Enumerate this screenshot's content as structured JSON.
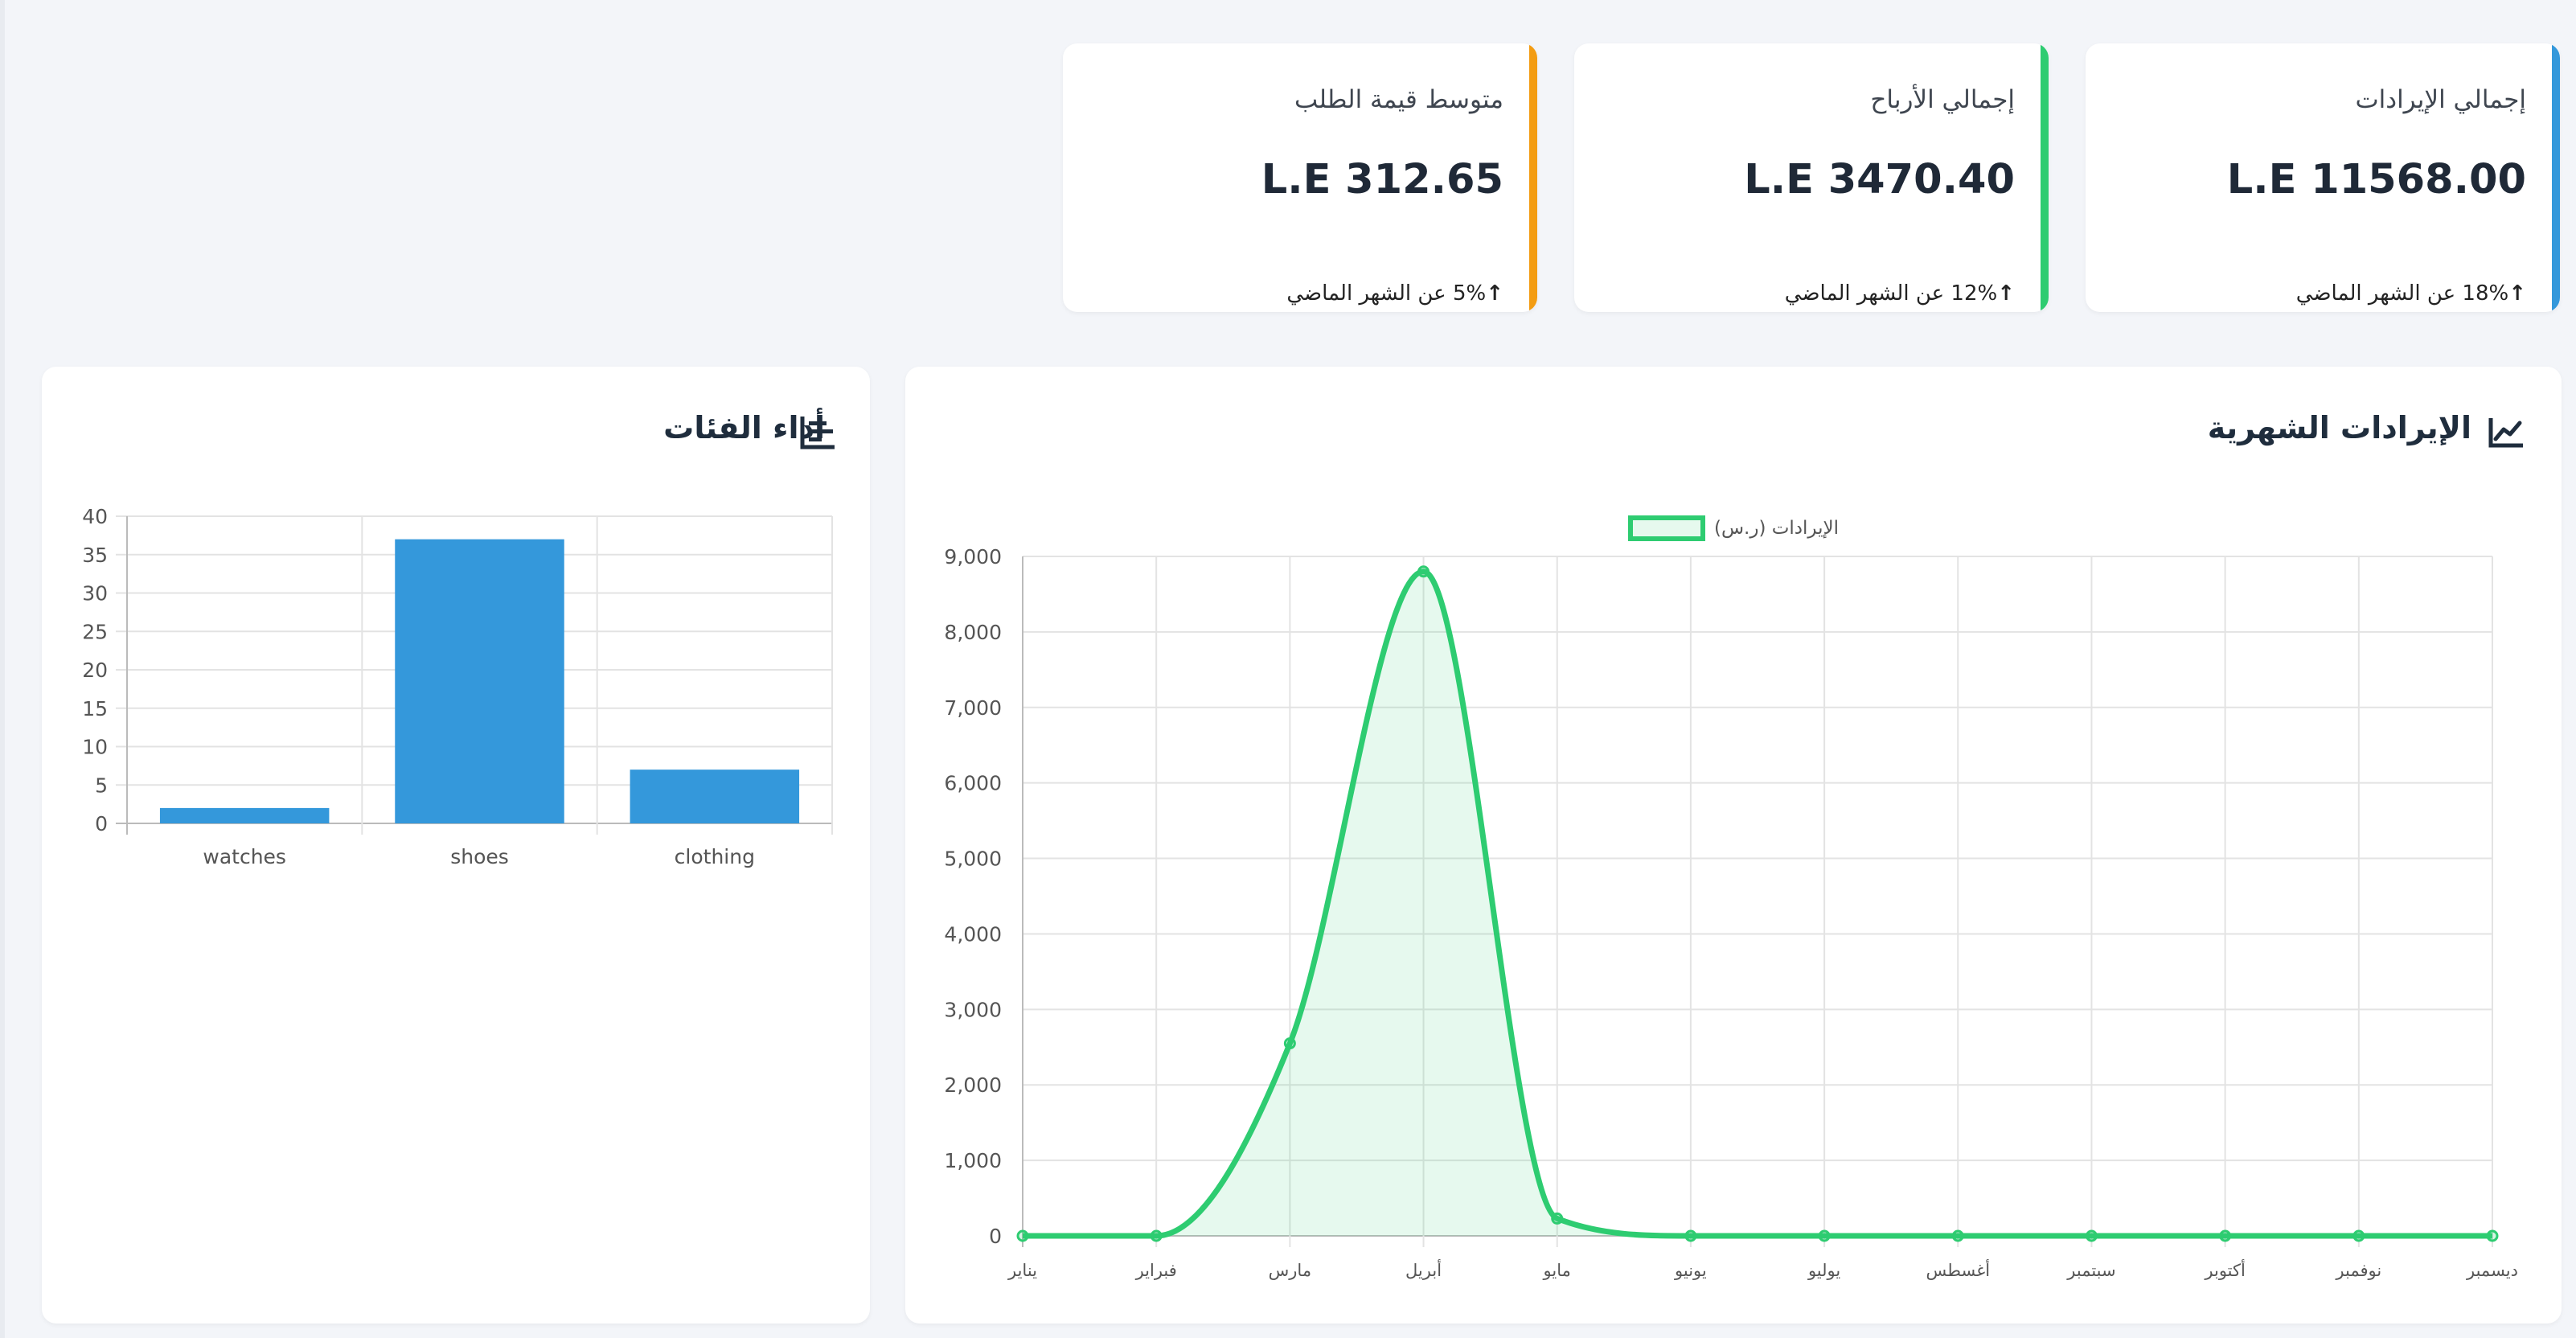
{
  "stats": [
    {
      "title": "إجمالي الإيرادات",
      "value": "L.E 11568.00",
      "change_arrow": "↑",
      "change": "18% عن الشهر الماضي",
      "color": "#3498db"
    },
    {
      "title": "إجمالي الأرباح",
      "value": "L.E 3470.40",
      "change_arrow": "↑",
      "change": "12% عن الشهر الماضي",
      "color": "#2ecc71"
    },
    {
      "title": "متوسط قيمة الطلب",
      "value": "L.E 312.65",
      "change_arrow": "↑",
      "change": "5% عن الشهر الماضي",
      "color": "#f39c12"
    }
  ],
  "revenue_panel": {
    "title": "الإيرادات الشهرية",
    "icon": "line-chart-icon"
  },
  "category_panel": {
    "title": "أداء الفئات",
    "icon": "bar-chart-icon"
  },
  "chart_data": [
    {
      "type": "line",
      "title": "",
      "categories": [
        "يناير",
        "فبراير",
        "مارس",
        "أبريل",
        "مايو",
        "يونيو",
        "يوليو",
        "أغسطس",
        "سبتمبر",
        "أكتوبر",
        "نوفمبر",
        "ديسمبر"
      ],
      "series": [
        {
          "name": "الإيرادات (ر.س)",
          "values": [
            0,
            0,
            2550,
            8800,
            230,
            0,
            0,
            0,
            0,
            0,
            0,
            0
          ],
          "color": "#2ecc71"
        }
      ],
      "ylim": [
        0,
        9000
      ],
      "yticks": [
        "0",
        "1,000",
        "2,000",
        "3,000",
        "4,000",
        "5,000",
        "6,000",
        "7,000",
        "8,000",
        "9,000"
      ],
      "x_reversed": false,
      "grid": true,
      "legend": "top-center",
      "fill": true
    },
    {
      "type": "bar",
      "title": "",
      "categories": [
        "watches",
        "shoes",
        "clothing"
      ],
      "values": [
        2,
        37,
        7
      ],
      "ylim": [
        0,
        40
      ],
      "yticks": [
        "0",
        "5",
        "10",
        "15",
        "20",
        "25",
        "30",
        "35",
        "40"
      ],
      "color": "#3498db",
      "grid": true
    }
  ]
}
